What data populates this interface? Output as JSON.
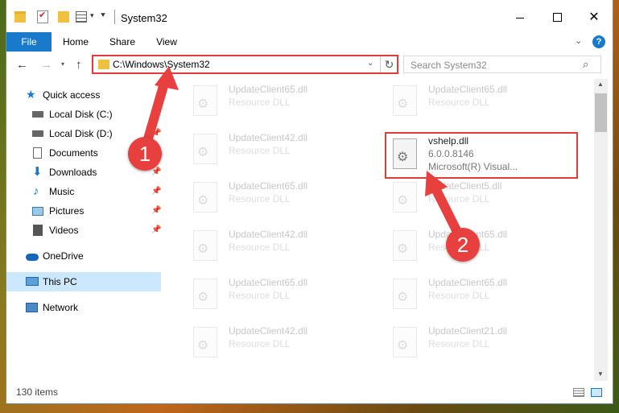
{
  "window": {
    "title": "System32"
  },
  "ribbon": {
    "tabs": [
      "File",
      "Home",
      "Share",
      "View"
    ]
  },
  "address": {
    "path": "C:\\Windows\\System32"
  },
  "search": {
    "placeholder": "Search System32"
  },
  "sidebar": {
    "items": [
      {
        "label": "Quick access",
        "icon": "star-icon",
        "pinned": false
      },
      {
        "label": "Local Disk (C:)",
        "icon": "drive-icon",
        "pinned": true
      },
      {
        "label": "Local Disk (D:)",
        "icon": "drive-icon",
        "pinned": true
      },
      {
        "label": "Documents",
        "icon": "document-icon",
        "pinned": true
      },
      {
        "label": "Downloads",
        "icon": "download-icon",
        "pinned": true
      },
      {
        "label": "Music",
        "icon": "music-icon",
        "pinned": true
      },
      {
        "label": "Pictures",
        "icon": "pictures-icon",
        "pinned": true
      },
      {
        "label": "Videos",
        "icon": "video-icon",
        "pinned": true
      },
      {
        "label": "OneDrive",
        "icon": "cloud-icon",
        "pinned": false
      },
      {
        "label": "This PC",
        "icon": "computer-icon",
        "pinned": false,
        "selected": true
      },
      {
        "label": "Network",
        "icon": "network-icon",
        "pinned": false
      }
    ]
  },
  "files": {
    "left": [
      {
        "name": "UpdateClient65.dll",
        "type": "Resource DLL"
      },
      {
        "name": "UpdateClient42.dll",
        "type": "Resource DLL"
      },
      {
        "name": "UpdateClient65.dll",
        "type": "Resource DLL"
      },
      {
        "name": "UpdateClient42.dll",
        "type": "Resource DLL"
      },
      {
        "name": "UpdateClient65.dll",
        "type": "Resource DLL"
      },
      {
        "name": "UpdateClient42.dll",
        "type": "Resource DLL"
      }
    ],
    "right": [
      {
        "name": "UpdateClient65.dll",
        "type": "Resource DLL"
      },
      {
        "name": "UpdateClient5.dll",
        "type": "Resource DLL"
      },
      {
        "name": "UpdateClient65.dll",
        "type": "Resource DLL"
      },
      {
        "name": "UpdateClient65.dll",
        "type": "Resource DLL"
      },
      {
        "name": "UpdateClient21.dll",
        "type": "Resource DLL"
      }
    ],
    "highlighted": {
      "name": "vshelp.dll",
      "version": "6.0.0.8146",
      "company": "Microsoft(R) Visual..."
    }
  },
  "status": {
    "item_count": "130 items"
  },
  "annotations": [
    "1",
    "2"
  ],
  "colors": {
    "accent": "#1979ca",
    "highlight": "#e23b3b"
  }
}
